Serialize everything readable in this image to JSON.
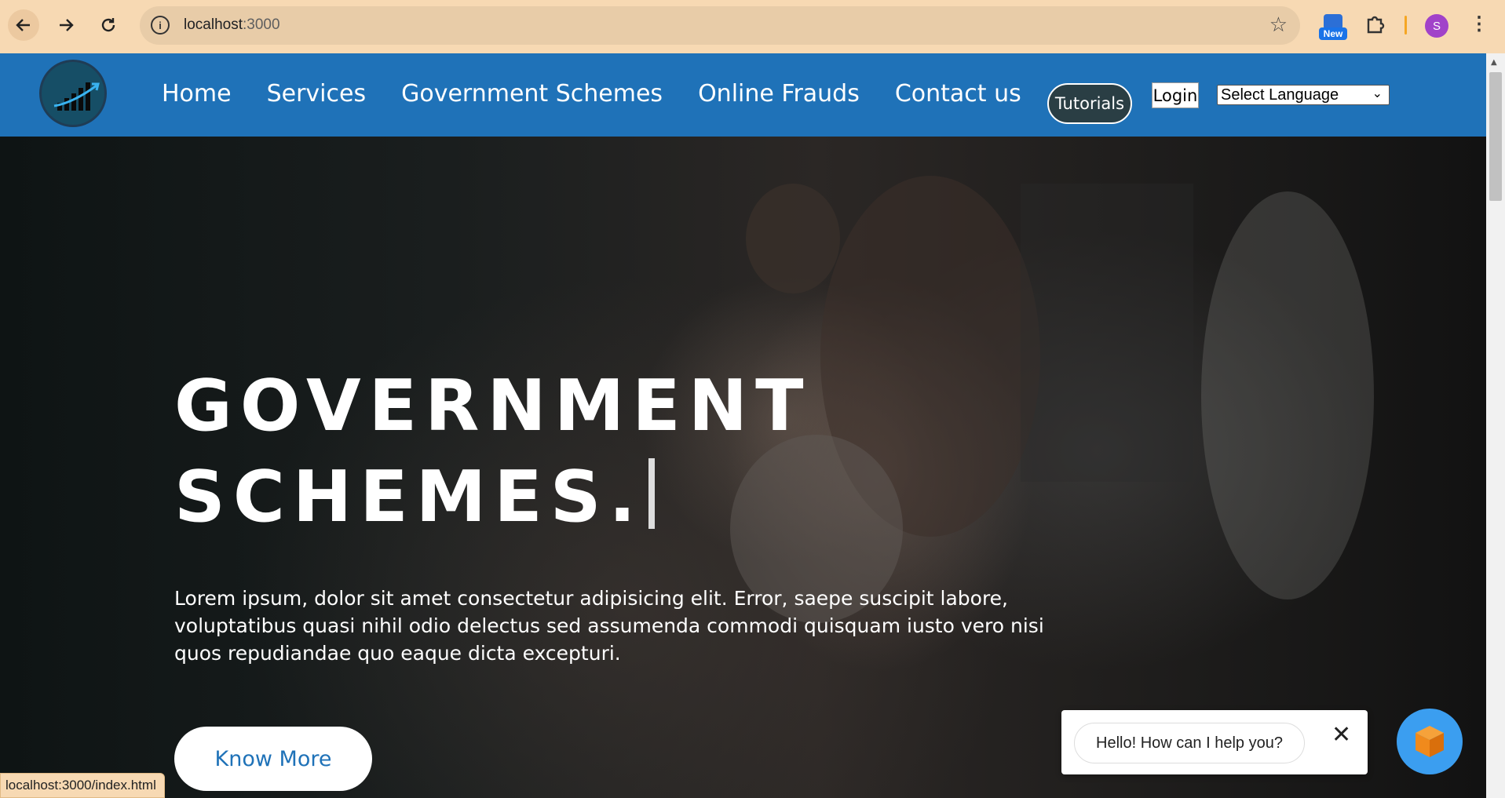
{
  "browser": {
    "url_host": "localhost",
    "url_port": ":3000",
    "extension_badge": "New",
    "profile_initial": "S",
    "status_url": "localhost:3000/index.html",
    "icons": [
      "back-arrow-icon",
      "forward-arrow-icon",
      "reload-icon",
      "site-info-icon",
      "bookmark-star-icon",
      "extension-new-icon",
      "puzzle-icon",
      "kebab-menu-icon"
    ]
  },
  "header": {
    "nav": [
      "Home",
      "Services",
      "Government Schemes",
      "Online Frauds",
      "Contact us"
    ],
    "tutorials_label": "Tutorials",
    "login_label": "Login",
    "language_select": "Select Language",
    "colors": {
      "header_bg": "#1f72b8",
      "tutorials_bg": "#2a3e44"
    }
  },
  "hero": {
    "title_line1": "GOVERNMENT",
    "title_line2": "SCHEMES.",
    "text": "Lorem ipsum, dolor sit amet consectetur adipisicing elit. Error, saepe suscipit labore, voluptatibus quasi nihil odio delectus sed assumenda commodi quisquam iusto vero nisi quos repudiandae quo eaque dicta excepturi.",
    "cta_label": "Know More"
  },
  "chat": {
    "greeting": "Hello! How can I help you?",
    "close_icon": "close-icon",
    "launcher_icon": "cube-icon",
    "launcher_color": "#3b9ef0"
  }
}
